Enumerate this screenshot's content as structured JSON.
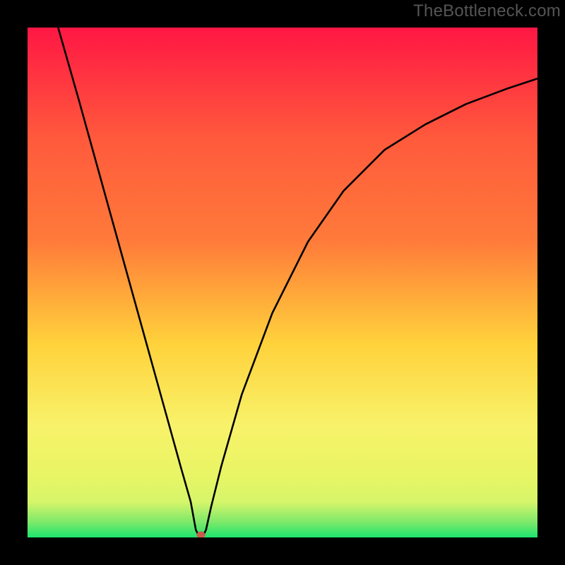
{
  "watermark": "TheBottleneck.com",
  "chart_data": {
    "type": "line",
    "title": "",
    "xlabel": "",
    "ylabel": "",
    "x_range": [
      0,
      100
    ],
    "y_range": [
      0,
      100
    ],
    "minimum_x": 34,
    "minimum_y": 0,
    "series": [
      {
        "name": "curve",
        "points": [
          {
            "x": 6,
            "y": 100
          },
          {
            "x": 10,
            "y": 86
          },
          {
            "x": 15,
            "y": 68
          },
          {
            "x": 20,
            "y": 50
          },
          {
            "x": 25,
            "y": 32
          },
          {
            "x": 30,
            "y": 14
          },
          {
            "x": 32,
            "y": 7
          },
          {
            "x": 33,
            "y": 1.5
          },
          {
            "x": 33.5,
            "y": 0.5
          },
          {
            "x": 34.5,
            "y": 0.5
          },
          {
            "x": 35,
            "y": 1.5
          },
          {
            "x": 36,
            "y": 6
          },
          {
            "x": 38,
            "y": 14
          },
          {
            "x": 42,
            "y": 28
          },
          {
            "x": 48,
            "y": 44
          },
          {
            "x": 55,
            "y": 58
          },
          {
            "x": 62,
            "y": 68
          },
          {
            "x": 70,
            "y": 76
          },
          {
            "x": 78,
            "y": 81
          },
          {
            "x": 86,
            "y": 85
          },
          {
            "x": 94,
            "y": 88
          },
          {
            "x": 100,
            "y": 90
          }
        ]
      }
    ],
    "marker": {
      "x": 34,
      "y": 0.5
    },
    "background_gradient": {
      "top_color": "#ff1744",
      "upper_mid_color": "#ff7b3a",
      "mid_color": "#ffd23b",
      "lower_mid_color": "#f8f26a",
      "band_color": "#d6f56a",
      "bottom_color": "#1de46e"
    },
    "frame_color": "#000000",
    "frame_thickness_ratio": 0.049,
    "curve_color": "#000000",
    "curve_width": 2.6,
    "marker_color": "#cc5a4a"
  }
}
